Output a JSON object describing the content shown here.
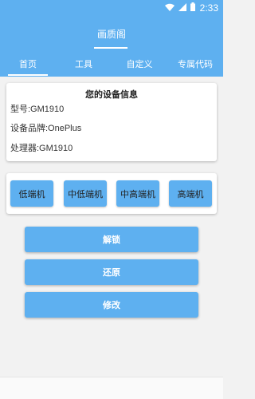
{
  "status_bar": {
    "time": "2:33",
    "icons": [
      "wifi-icon",
      "signal-icon",
      "battery-icon"
    ]
  },
  "app_bar": {
    "title": "画质阁"
  },
  "tabs": [
    {
      "label": "首页",
      "active": true
    },
    {
      "label": "工具",
      "active": false
    },
    {
      "label": "自定义",
      "active": false
    },
    {
      "label": "专属代码",
      "active": false
    }
  ],
  "device_info": {
    "title": "您的设备信息",
    "model": "型号:GM1910",
    "brand": "设备品牌:OnePlus",
    "processor": "处理器:GM1910"
  },
  "levels": [
    "低端机",
    "中低端机",
    "中高端机",
    "高端机"
  ],
  "actions": {
    "unlock": "解锁",
    "restore": "还原",
    "modify": "修改"
  },
  "colors": {
    "accent": "#5eb0f0",
    "background": "#f2f2f2"
  }
}
